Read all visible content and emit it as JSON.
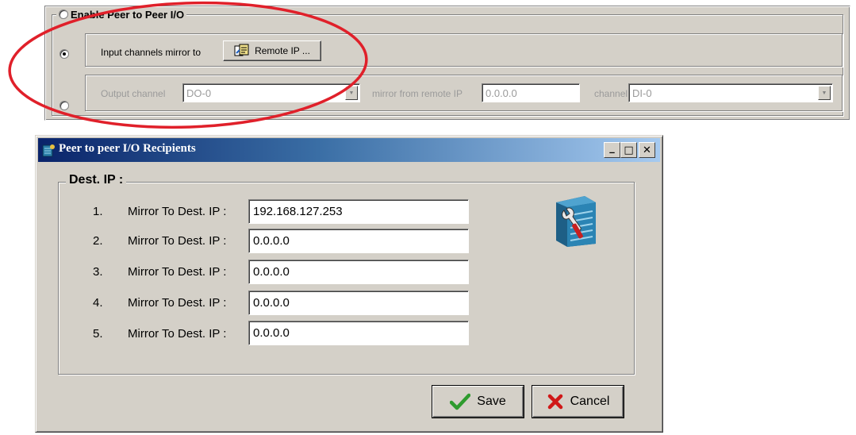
{
  "peer_panel": {
    "title": "Enable Peer to Peer I/O",
    "input_option_label": "Input channels mirror to",
    "remote_ip_button": "Remote IP ...",
    "output_channel_label": "Output channel",
    "output_channel_value": "DO-0",
    "mirror_from_label": "mirror from remote IP",
    "mirror_from_value": "0.0.0.0",
    "channel_label": "channel",
    "channel_value": "DI-0"
  },
  "dialog": {
    "title": "Peer to peer I/O Recipients",
    "caption_buttons": {
      "minimize": "_",
      "maximize": "□",
      "close": "✕"
    },
    "group_title": "Dest. IP :",
    "rows": [
      {
        "num": "1.",
        "label": "Mirror To Dest. IP :",
        "value": "192.168.127.253"
      },
      {
        "num": "2.",
        "label": "Mirror To Dest. IP :",
        "value": "0.0.0.0"
      },
      {
        "num": "3.",
        "label": "Mirror To Dest. IP :",
        "value": "0.0.0.0"
      },
      {
        "num": "4.",
        "label": "Mirror To Dest. IP :",
        "value": "0.0.0.0"
      },
      {
        "num": "5.",
        "label": "Mirror To Dest. IP :",
        "value": "0.0.0.0"
      }
    ],
    "save_button": "Save",
    "cancel_button": "Cancel"
  },
  "colors": {
    "annotation_circle": "#e0202a",
    "window_face": "#d4d0c8",
    "titlebar_start": "#0a246a",
    "titlebar_end": "#a6caf0",
    "save_check": "#2e9b2e",
    "cancel_x": "#d01818"
  },
  "icons": [
    "tools-server-icon",
    "remote-ip-icon",
    "check-icon",
    "cancel-x-icon"
  ]
}
